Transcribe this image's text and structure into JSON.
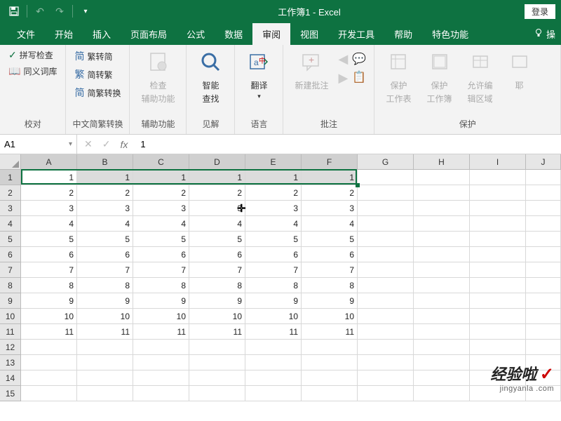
{
  "titlebar": {
    "title": "工作簿1 - Excel",
    "login": "登录"
  },
  "tabs": [
    {
      "id": "file",
      "label": "文件"
    },
    {
      "id": "home",
      "label": "开始"
    },
    {
      "id": "insert",
      "label": "插入"
    },
    {
      "id": "layout",
      "label": "页面布局"
    },
    {
      "id": "formula",
      "label": "公式"
    },
    {
      "id": "data",
      "label": "数据"
    },
    {
      "id": "review",
      "label": "审阅",
      "active": true
    },
    {
      "id": "view",
      "label": "视图"
    },
    {
      "id": "dev",
      "label": "开发工具"
    },
    {
      "id": "help",
      "label": "帮助"
    },
    {
      "id": "special",
      "label": "特色功能"
    }
  ],
  "tab_extra": "操",
  "ribbon": {
    "proofing": {
      "spell": "拼写检查",
      "thesaurus": "同义词库",
      "label": "校对"
    },
    "chinese": {
      "t2s": "繁转简",
      "s2t": "简转繁",
      "convert": "简繁转换",
      "label": "中文简繁转换"
    },
    "accessibility": {
      "check1": "检查",
      "check2": "辅助功能",
      "label": "辅助功能"
    },
    "insights": {
      "smart1": "智能",
      "smart2": "查找",
      "label": "见解"
    },
    "language": {
      "translate": "翻译",
      "label": "语言"
    },
    "comments": {
      "new": "新建批注",
      "label": "批注"
    },
    "protect": {
      "sheet1": "保护",
      "sheet2": "工作表",
      "book1": "保护",
      "book2": "工作簿",
      "range1": "允许编",
      "range2": "辑区域",
      "label": "保护"
    }
  },
  "namebox": "A1",
  "fx_label": "fx",
  "formula_value": "1",
  "columns": [
    "A",
    "B",
    "C",
    "D",
    "E",
    "F",
    "G",
    "H",
    "I",
    "J"
  ],
  "row_count": 15,
  "data_rows": 11,
  "selected_cols": 6,
  "selection": {
    "row": 1,
    "colStart": 1,
    "colEnd": 6
  },
  "cells": [
    [
      1,
      1,
      1,
      1,
      1,
      1
    ],
    [
      2,
      2,
      2,
      2,
      2,
      2
    ],
    [
      3,
      3,
      3,
      3,
      3,
      3
    ],
    [
      4,
      4,
      4,
      4,
      4,
      4
    ],
    [
      5,
      5,
      5,
      5,
      5,
      5
    ],
    [
      6,
      6,
      6,
      6,
      6,
      6
    ],
    [
      7,
      7,
      7,
      7,
      7,
      7
    ],
    [
      8,
      8,
      8,
      8,
      8,
      8
    ],
    [
      9,
      9,
      9,
      9,
      9,
      9
    ],
    [
      10,
      10,
      10,
      10,
      10,
      10
    ],
    [
      11,
      11,
      11,
      11,
      11,
      11
    ]
  ],
  "cursor": {
    "row": 3,
    "col": 4,
    "glyph": "✛"
  },
  "watermark": {
    "main": "经验啦",
    "check": "✓",
    "sub": "jingyanla .com"
  }
}
